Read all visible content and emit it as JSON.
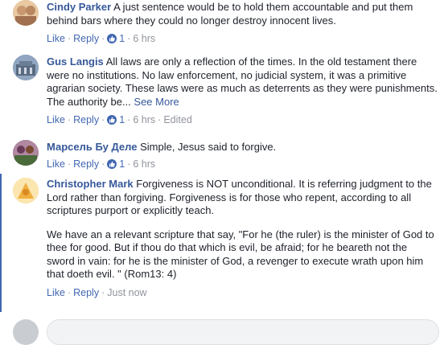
{
  "actions": {
    "like": "Like",
    "reply": "Reply",
    "sep": "·"
  },
  "comments": [
    {
      "author": "Cindy Parker",
      "text": "A just sentence would be to hold them accountable and put them behind bars where they could no longer destroy innocent lives.",
      "likes": "1",
      "time": "6 hrs",
      "edited": "",
      "see_more": "",
      "avatar_color": "#d9b48a"
    },
    {
      "author": "Gus Langis",
      "text": "All laws are only a reflection of the times. In the old testament there were no institutions. No law enforcement, no judicial system, it was a primitive agrarian society. These laws were as much as deterrents as they were punishments. The authority be...",
      "likes": "1",
      "time": "6 hrs",
      "edited": "Edited",
      "see_more": "See More",
      "avatar_color": "#6b7f99"
    },
    {
      "author": "Марсель Бу Деле",
      "text": "Simple, Jesus said to forgive.",
      "likes": "1",
      "time": "6 hrs",
      "edited": "",
      "see_more": "",
      "avatar_color": "#8a5a7a"
    },
    {
      "author": "Christopher Mark",
      "text": "Forgiveness is NOT unconditional. It is referring judgment to the Lord rather than forgiving. Forgiveness is for those who repent, according to all scriptures purport or explicitly teach.",
      "text2": "We have an a relevant scripture that say, \"For he (the ruler) is the minister of God to thee for good. But if thou do that which is evil, be afraid; for he beareth not the sword in vain: for he is the minister of God, a revenger to execute wrath upon him that doeth evil. \" (Rom13: 4)",
      "likes": "",
      "time": "Just now",
      "edited": "",
      "see_more": "",
      "avatar_color": "#f0c060"
    }
  ],
  "colors": {
    "link": "#365899",
    "action": "#4267b2",
    "meta": "#90949c",
    "text": "#1d2129"
  }
}
